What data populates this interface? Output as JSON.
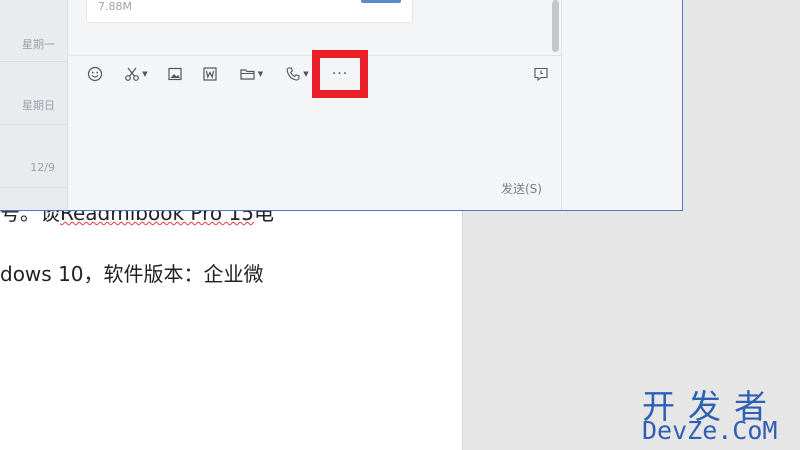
{
  "document": {
    "line1_prefix": "号。谈",
    "line1_underlined": "Readmibook Pro 15",
    "line1_suffix": "电",
    "line2": "dows 10，软件版本：企业微"
  },
  "chat": {
    "conversations": [
      {
        "date": "星期一"
      },
      {
        "date": "星期日"
      },
      {
        "date": "12/9"
      }
    ],
    "message": {
      "file_size": "7.88M"
    },
    "toolbar": {
      "emoji": "emoji-icon",
      "screenshot": "scissors-icon",
      "image": "image-icon",
      "word": "word-doc-icon",
      "folder": "folder-icon",
      "call": "phone-icon",
      "more": "···",
      "history": "chat-history-icon"
    },
    "send_label": "发送(S)"
  },
  "watermark": {
    "cn": "开发者",
    "en": "DevZe.CoM"
  },
  "colors": {
    "highlight": "#ea1f2a",
    "accent": "#4c7bc1",
    "watermark": "#2f5fb5"
  }
}
